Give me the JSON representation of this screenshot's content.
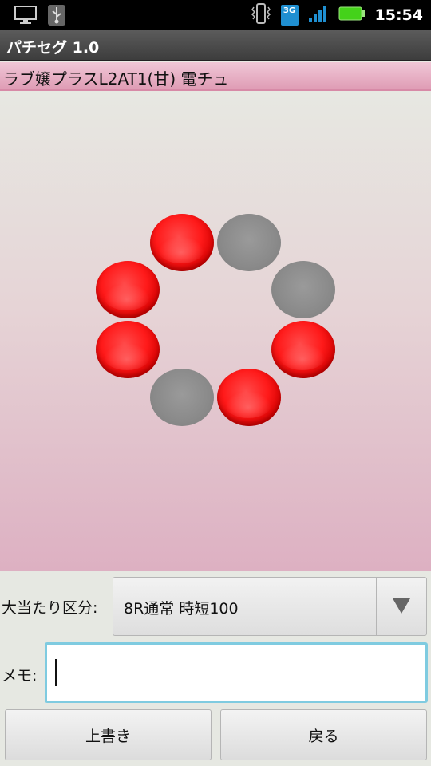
{
  "status_bar": {
    "time": "15:54",
    "network_type": "3G",
    "icons": [
      "monitor-icon",
      "usb-icon",
      "vibrate-icon",
      "network-3g-icon",
      "signal-icon",
      "battery-icon"
    ]
  },
  "app": {
    "title": "パチセグ 1.0"
  },
  "machine": {
    "name": "ラブ嬢プラスL2AT1(甘) 電チュ"
  },
  "lamps": [
    {
      "state": "on"
    },
    {
      "state": "off"
    },
    {
      "state": "on"
    },
    {
      "state": "off"
    },
    {
      "state": "on"
    },
    {
      "state": "on"
    },
    {
      "state": "off"
    },
    {
      "state": "on"
    }
  ],
  "form": {
    "category_label": "大当たり区分:",
    "category_value": "8R通常 時短100",
    "memo_label": "メモ:",
    "memo_value": ""
  },
  "buttons": {
    "overwrite": "上書き",
    "back": "戻る"
  },
  "colors": {
    "lamp_on": "#ff1a1a",
    "lamp_off": "#8a8a8a",
    "banner": "#df9cb5",
    "focus": "#7fcbe0"
  }
}
